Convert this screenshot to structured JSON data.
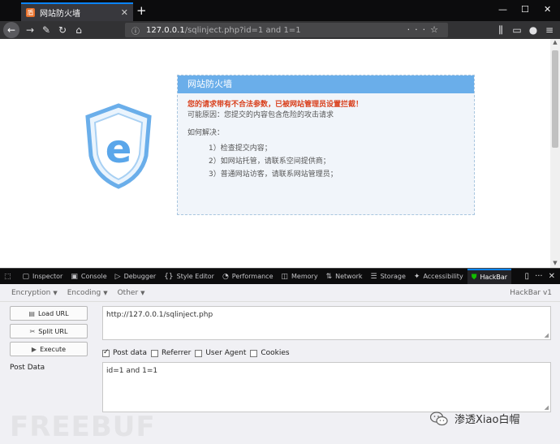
{
  "browser": {
    "tab_title": "网站防火墙",
    "tab_close": "✕",
    "new_tab": "+",
    "url_host": "127.0.0.1",
    "url_path": "/sqlinject.php?id=1 and 1=1",
    "window_controls": [
      "—",
      "☐",
      "✕"
    ]
  },
  "page": {
    "header": "网站防火墙",
    "alert": "您的请求带有不合法参数，已被网站管理员设置拦截！",
    "reason": "可能原因：您提交的内容包含危险的攻击请求",
    "how_title": "如何解决：",
    "steps": [
      "1）检查提交内容；",
      "2）如网站托管，请联系空间提供商；",
      "3）普通网站访客，请联系网站管理员；"
    ],
    "shield_letter": "e"
  },
  "devtools": {
    "tabs": [
      "Inspector",
      "Console",
      "Debugger",
      "Style Editor",
      "Performance",
      "Memory",
      "Network",
      "Storage",
      "Accessibility",
      "HackBar"
    ],
    "active_tab": "HackBar"
  },
  "hackbar": {
    "menus": [
      "Encryption",
      "Encoding",
      "Other"
    ],
    "version": "HackBar v1",
    "buttons": [
      "Load URL",
      "Split URL",
      "Execute"
    ],
    "url_value": "http://127.0.0.1/sqlinject.php",
    "checkboxes": [
      {
        "label": "Post data",
        "checked": true
      },
      {
        "label": "Referrer",
        "checked": false
      },
      {
        "label": "User Agent",
        "checked": false
      },
      {
        "label": "Cookies",
        "checked": false
      }
    ],
    "post_label": "Post Data",
    "post_value": "id=1 and 1=1"
  },
  "watermark": {
    "left": "FREEBUF",
    "right": "渗透Xiao白帽"
  },
  "colors": {
    "accent": "#0a84ff",
    "waf_header": "#6aaeea",
    "alert": "#d9401d"
  }
}
